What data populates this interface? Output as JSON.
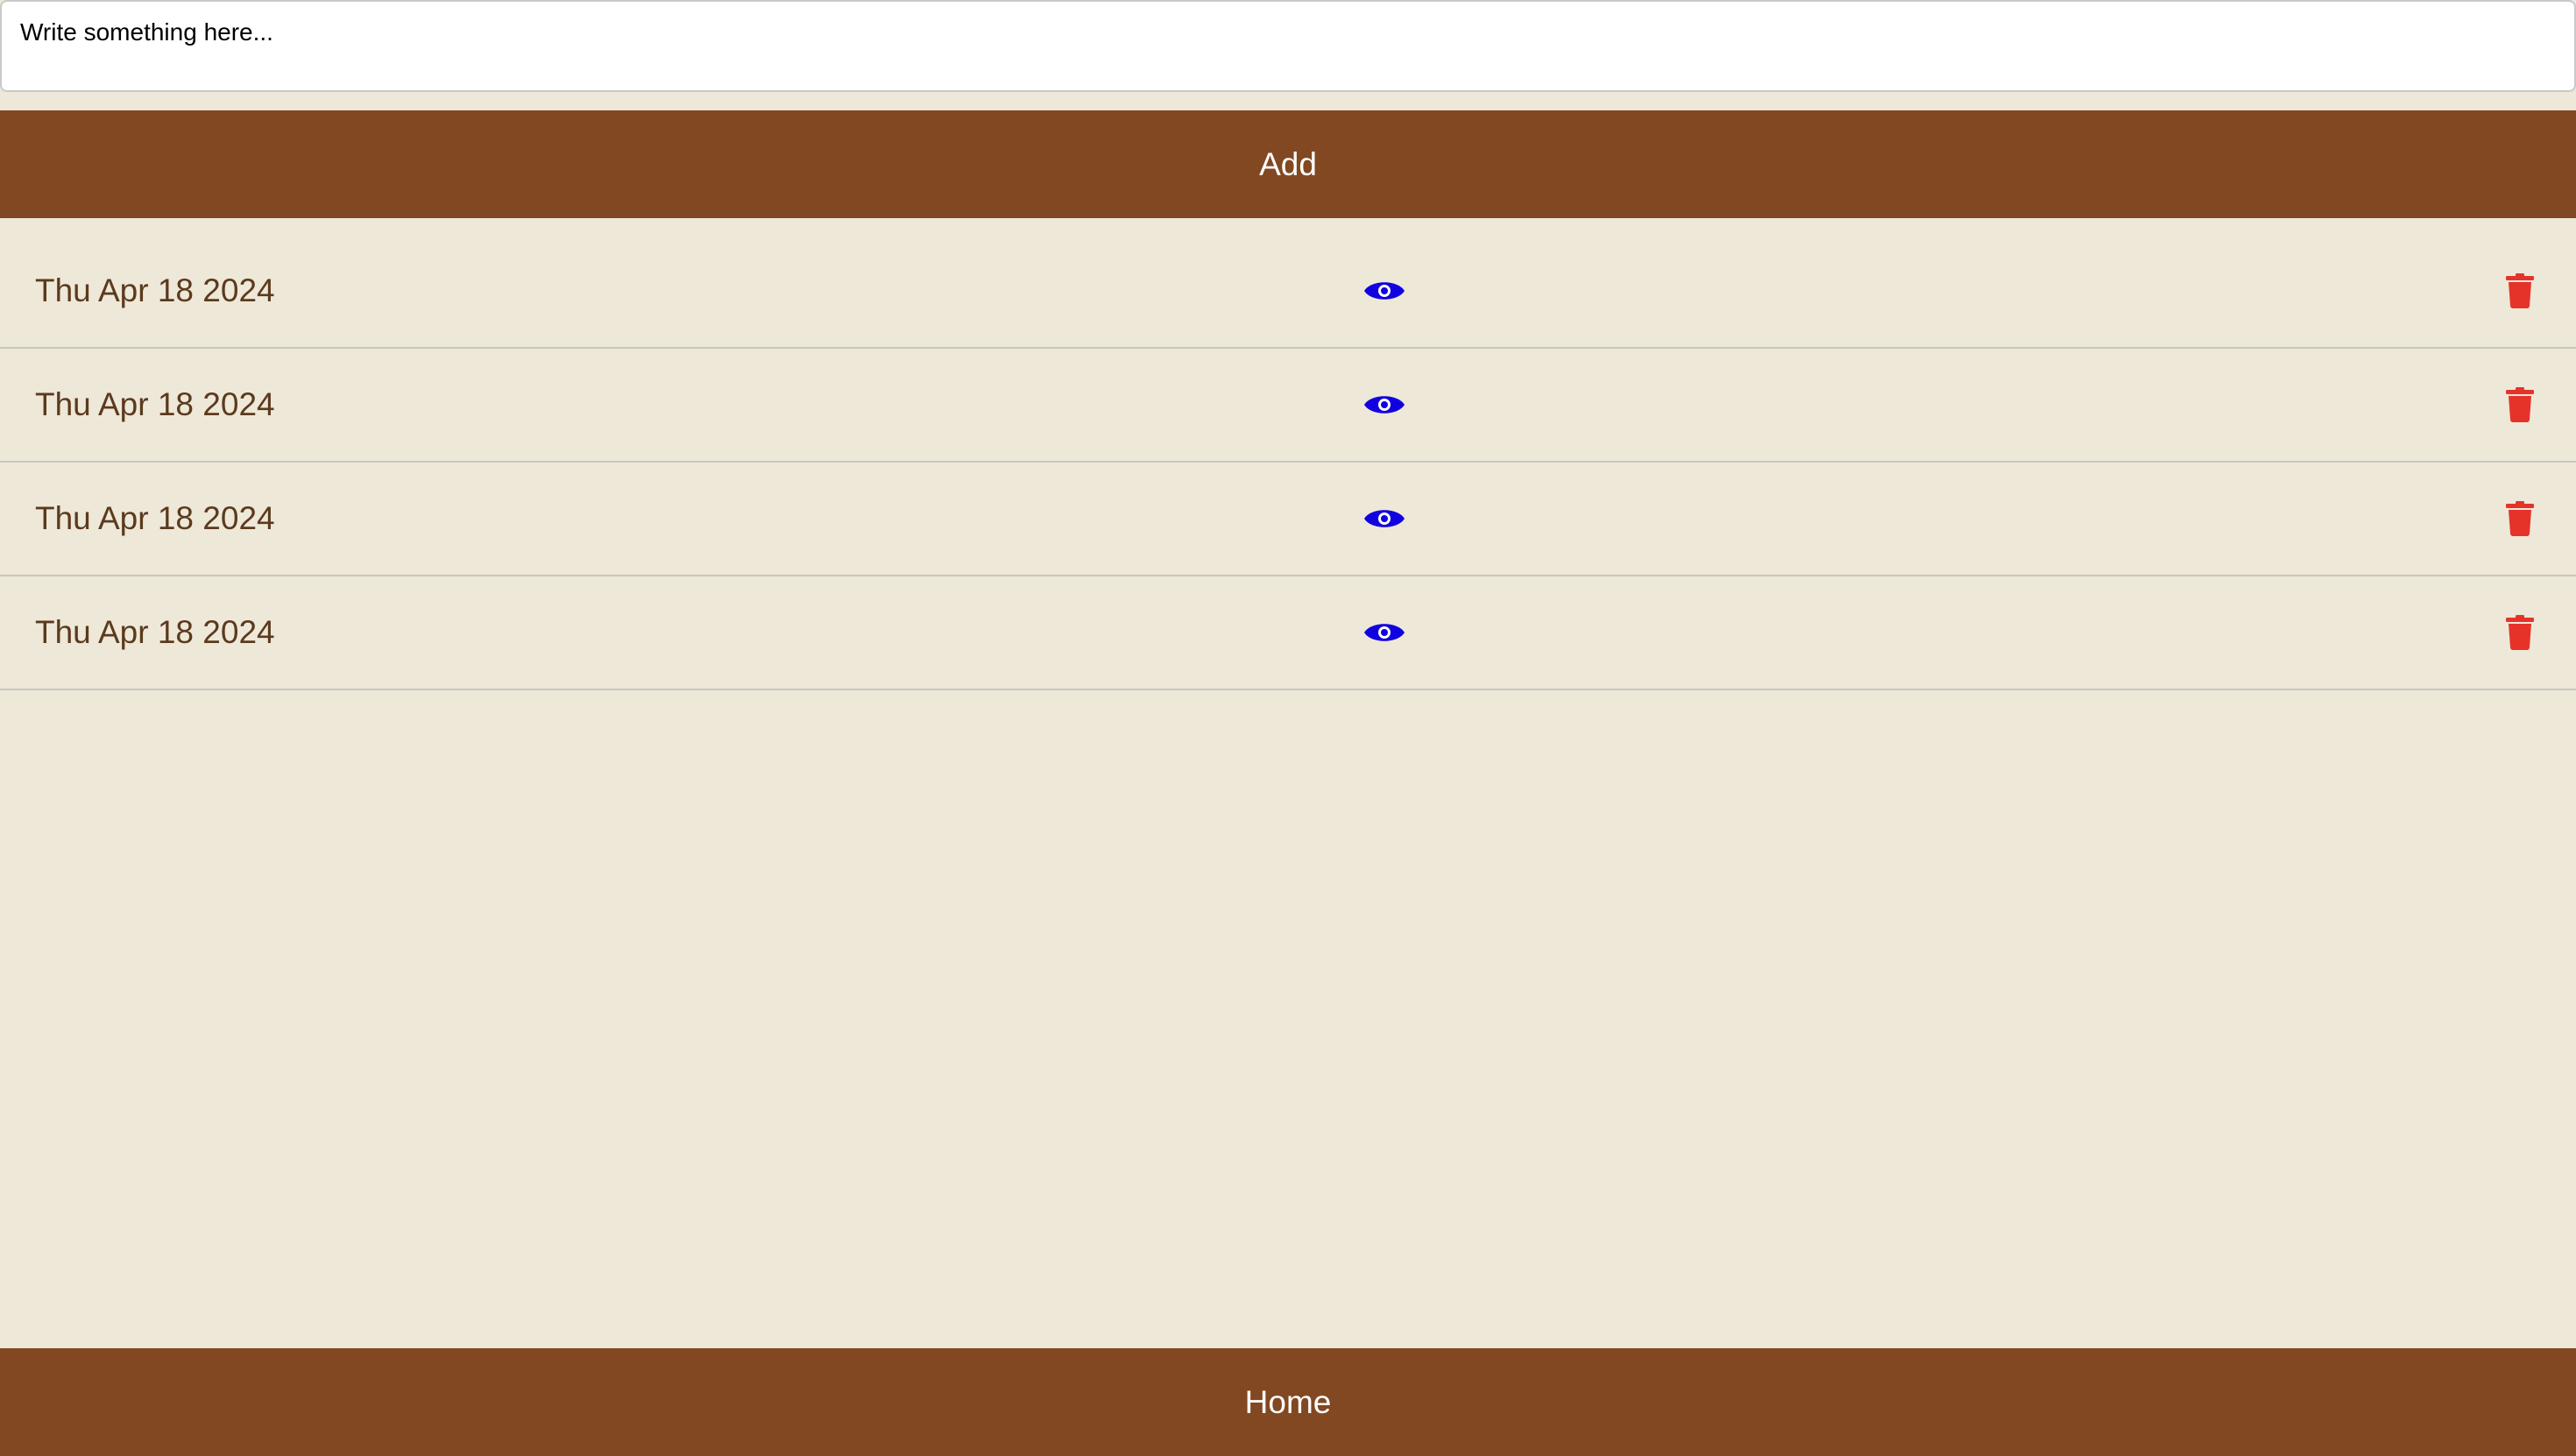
{
  "note_input": {
    "value": "",
    "placeholder": "Write something here..."
  },
  "add_button": {
    "label": "Add"
  },
  "entries": [
    {
      "date": "Thu Apr 18 2024",
      "view_icon": "eye-icon",
      "delete_icon": "trash-icon"
    },
    {
      "date": "Thu Apr 18 2024",
      "view_icon": "eye-icon",
      "delete_icon": "trash-icon"
    },
    {
      "date": "Thu Apr 18 2024",
      "view_icon": "eye-icon",
      "delete_icon": "trash-icon"
    },
    {
      "date": "Thu Apr 18 2024",
      "view_icon": "eye-icon",
      "delete_icon": "trash-icon"
    }
  ],
  "home_button": {
    "label": "Home"
  },
  "colors": {
    "background": "#EEE8D9",
    "bar": "#824821",
    "bar_text": "#FFFFFF",
    "date_text": "#5B3A1D",
    "view_icon": "#1100E0",
    "delete_icon": "#E5332A",
    "divider": "#C9C6BE"
  }
}
